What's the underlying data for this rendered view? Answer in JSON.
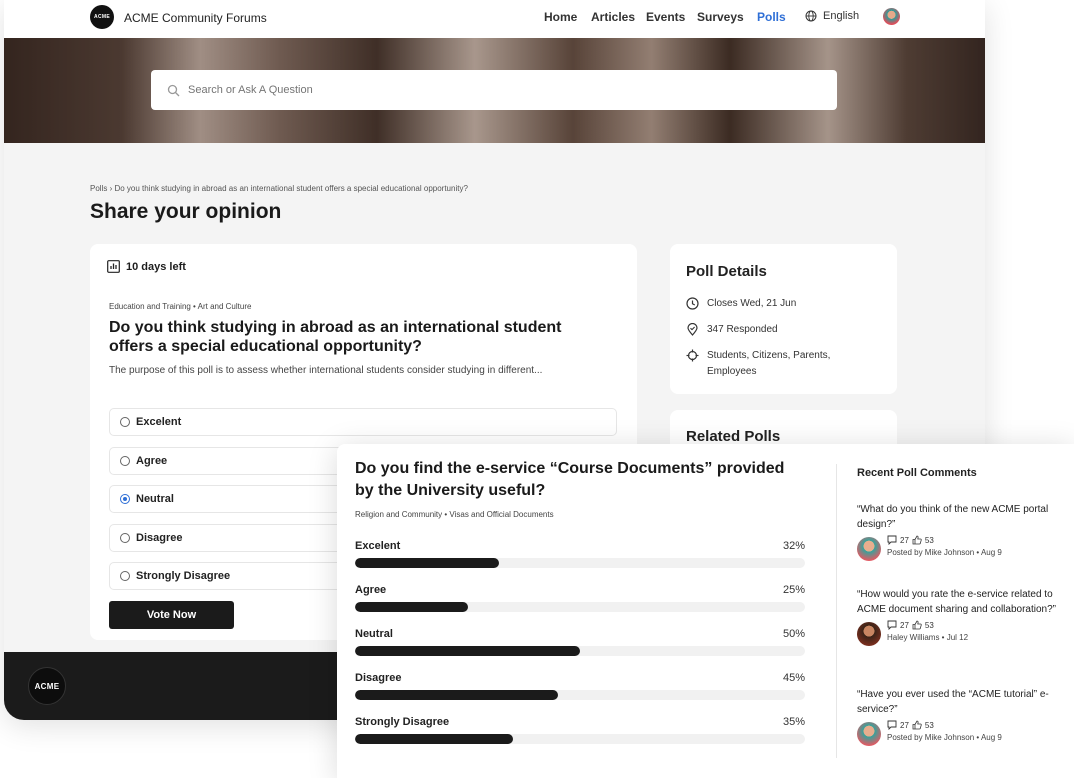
{
  "header": {
    "logo_text": "ACME",
    "site_title": "ACME Community Forums",
    "nav": [
      {
        "label": "Home"
      },
      {
        "label": "Articles"
      },
      {
        "label": "Events"
      },
      {
        "label": "Surveys"
      },
      {
        "label": "Polls",
        "active": true
      }
    ],
    "language": "English"
  },
  "search": {
    "placeholder": "Search or Ask A Question"
  },
  "breadcrumb": {
    "root": "Polls",
    "separator": "›",
    "current": "Do you think studying in abroad as an international student offers a special educational opportunity?"
  },
  "page_title": "Share your opinion",
  "poll": {
    "days_left": "10 days left",
    "categories": "Education and Training • Art and Culture",
    "question": "Do you think studying in abroad as an international student offers a special educational opportunity?",
    "description": "The purpose of this poll is to assess whether international students consider studying in different...",
    "options": [
      {
        "label": "Excelent",
        "selected": false
      },
      {
        "label": "Agree",
        "selected": false
      },
      {
        "label": "Neutral",
        "selected": true
      },
      {
        "label": "Disagree",
        "selected": false
      },
      {
        "label": "Strongly Disagree",
        "selected": false
      }
    ],
    "vote_label": "Vote Now"
  },
  "details": {
    "title": "Poll Details",
    "closes": "Closes Wed, 21 Jun",
    "responded": "347 Responded",
    "audience": "Students, Citizens, Parents, Employees"
  },
  "related": {
    "title": "Related Polls"
  },
  "footer": {
    "logo_text": "ACME"
  },
  "results": {
    "question": "Do you find the e-service “Course Documents” provided by the University useful?",
    "categories": "Religion and Community • Visas and Official Documents",
    "items": [
      {
        "label": "Excelent",
        "percent_label": "32%",
        "percent": 32
      },
      {
        "label": "Agree",
        "percent_label": "25%",
        "percent": 25
      },
      {
        "label": "Neutral",
        "percent_label": "50%",
        "percent": 50
      },
      {
        "label": "Disagree",
        "percent_label": "45%",
        "percent": 45
      },
      {
        "label": "Strongly Disagree",
        "percent_label": "35%",
        "percent": 35
      }
    ]
  },
  "comments": {
    "title": "Recent Poll Comments",
    "items": [
      {
        "text": "“What do you think of the new ACME portal design?”",
        "comments": "27",
        "likes": "53",
        "author": "Posted by Mike Johnson • Aug 9"
      },
      {
        "text": "“How would you rate the e-service related to ACME document sharing and collaboration?”",
        "comments": "27",
        "likes": "53",
        "author": "Haley Williams • Jul 12"
      },
      {
        "text": "“Have you ever used the “ACME tutorial” e-service?”",
        "comments": "27",
        "likes": "53",
        "author": "Posted by Mike Johnson • Aug 9"
      }
    ]
  },
  "colors": {
    "accent": "#2f6fd6",
    "bar": "#1b1b1b",
    "footer": "#1b1b1b"
  }
}
